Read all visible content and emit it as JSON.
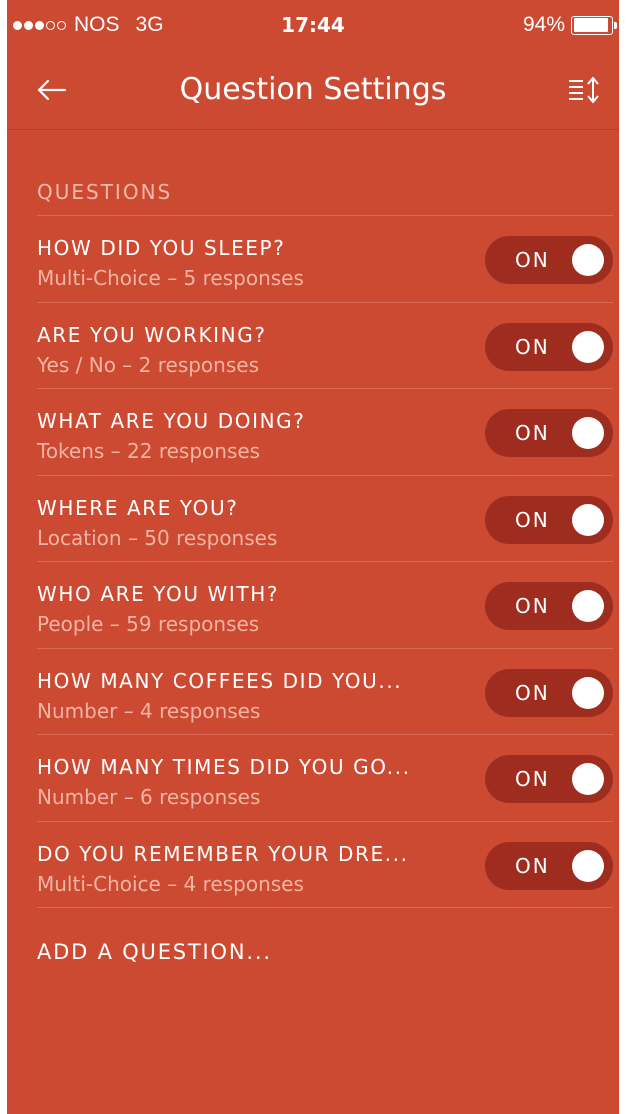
{
  "status_bar": {
    "signal_dots_filled": 3,
    "signal_dots_total": 5,
    "carrier": "NOS",
    "network": "3G",
    "time": "17:44",
    "battery_percent": "94%",
    "battery_level": 0.94
  },
  "nav": {
    "back_icon": "back-arrow-icon",
    "title": "Question Settings",
    "reorder_icon": "reorder-icon"
  },
  "section": {
    "header": "QUESTIONS"
  },
  "questions": [
    {
      "title": "HOW DID YOU SLEEP?",
      "subtitle": "Multi-Choice – 5 responses",
      "toggle": "ON"
    },
    {
      "title": "ARE YOU WORKING?",
      "subtitle": "Yes / No – 2 responses",
      "toggle": "ON"
    },
    {
      "title": "WHAT ARE YOU DOING?",
      "subtitle": "Tokens – 22 responses",
      "toggle": "ON"
    },
    {
      "title": "WHERE ARE YOU?",
      "subtitle": "Location – 50 responses",
      "toggle": "ON"
    },
    {
      "title": "WHO ARE YOU WITH?",
      "subtitle": "People – 59 responses",
      "toggle": "ON"
    },
    {
      "title": "HOW MANY COFFEES DID YOU...",
      "subtitle": "Number – 4 responses",
      "toggle": "ON"
    },
    {
      "title": "HOW MANY TIMES DID YOU GO...",
      "subtitle": "Number – 6 responses",
      "toggle": "ON"
    },
    {
      "title": "DO YOU REMEMBER YOUR DRE...",
      "subtitle": "Multi-Choice – 4 responses",
      "toggle": "ON"
    }
  ],
  "add_question": "ADD A QUESTION...",
  "colors": {
    "background": "#cc4a31",
    "toggle_track": "#9e2d1f",
    "subtitle_text": "#f2b3a3",
    "divider": "#d96a55"
  }
}
